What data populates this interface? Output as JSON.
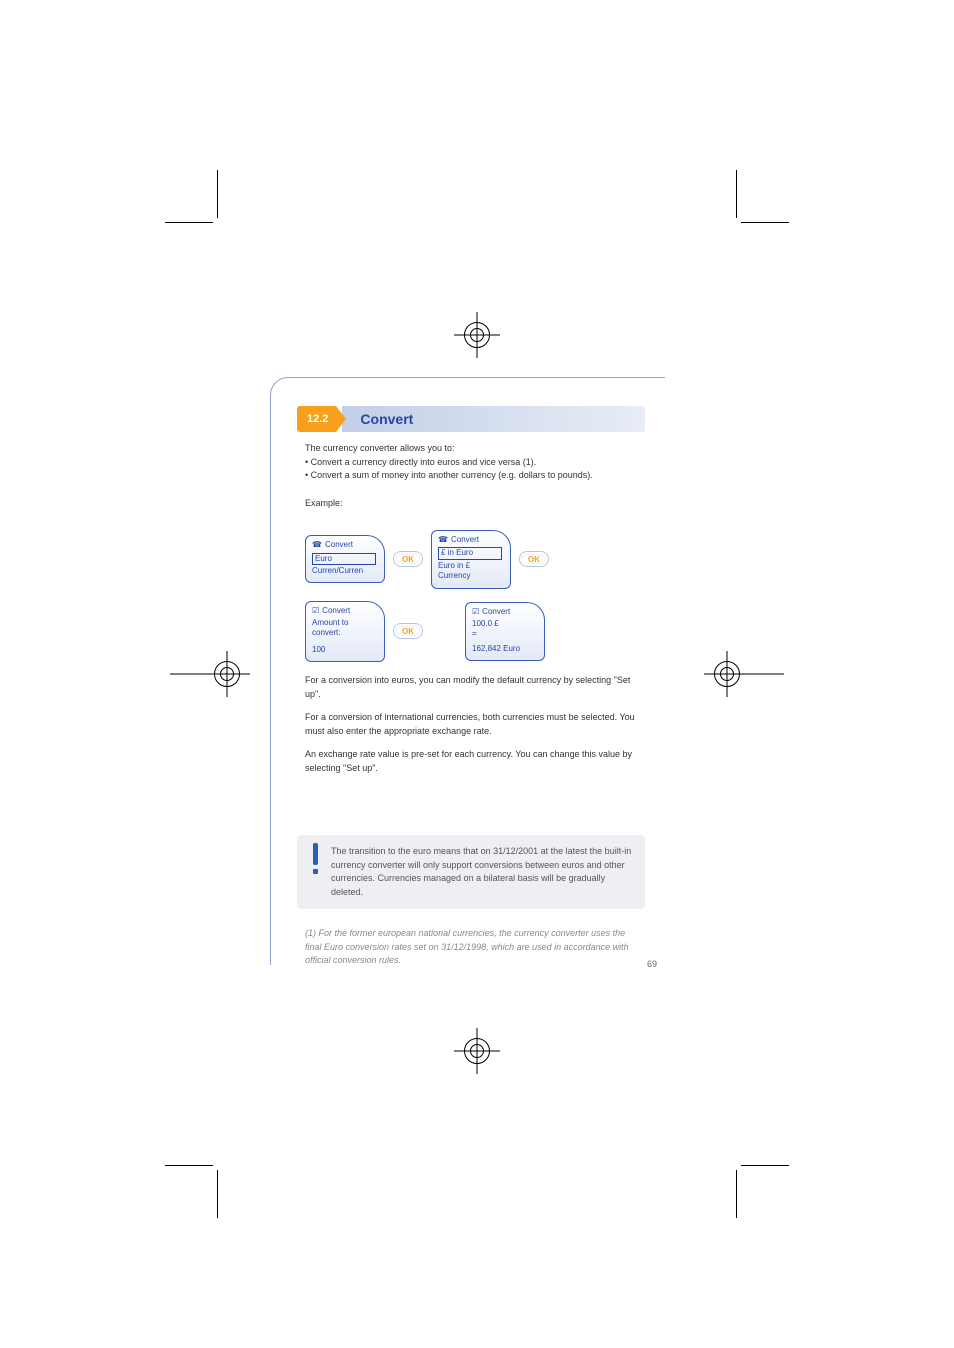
{
  "section": {
    "badge": "12.2",
    "title": "Convert"
  },
  "intro": {
    "p1": "The currency converter allows you to:",
    "b1": "Convert a currency directly into euros and vice versa (1).",
    "b2": "Convert a sum of money into another currency (e.g. dollars to pounds)."
  },
  "example_label": "Example:",
  "screens": {
    "s1": {
      "title": "Convert",
      "opt_sel": "Euro",
      "opt2": "Curren/Curren"
    },
    "s2": {
      "title": "Convert",
      "opt_sel": "£ in Euro",
      "opt2": "Euro in £",
      "opt3": "Currency"
    },
    "s3": {
      "title": "Convert",
      "line1": "Amount to",
      "line2": "convert:",
      "value": "100"
    },
    "s4": {
      "title": "Convert",
      "line1": "100.0 £",
      "eq": "=",
      "result": "162,842 Euro"
    }
  },
  "ok_label": "OK",
  "after": {
    "p1": "For a conversion into euros, you can modify the default currency by selecting \"Set up\".",
    "p2": "For a conversion of international currencies, both currencies must be selected. You must also enter the appropriate exchange rate.",
    "p3": "An exchange rate value is pre-set for each currency. You can change this value by selecting \"Set up\"."
  },
  "note": "The transition to the euro means that on 31/12/2001 at the latest the built-in currency converter will only support conversions between euros and other currencies. Currencies managed on a bilateral basis will be gradually deleted.",
  "footnote": "(1) For the former european national currencies, the currency converter uses the final Euro conversion rates set on 31/12/1998, which are used in accordance with official conversion rules.",
  "page_number": "69"
}
